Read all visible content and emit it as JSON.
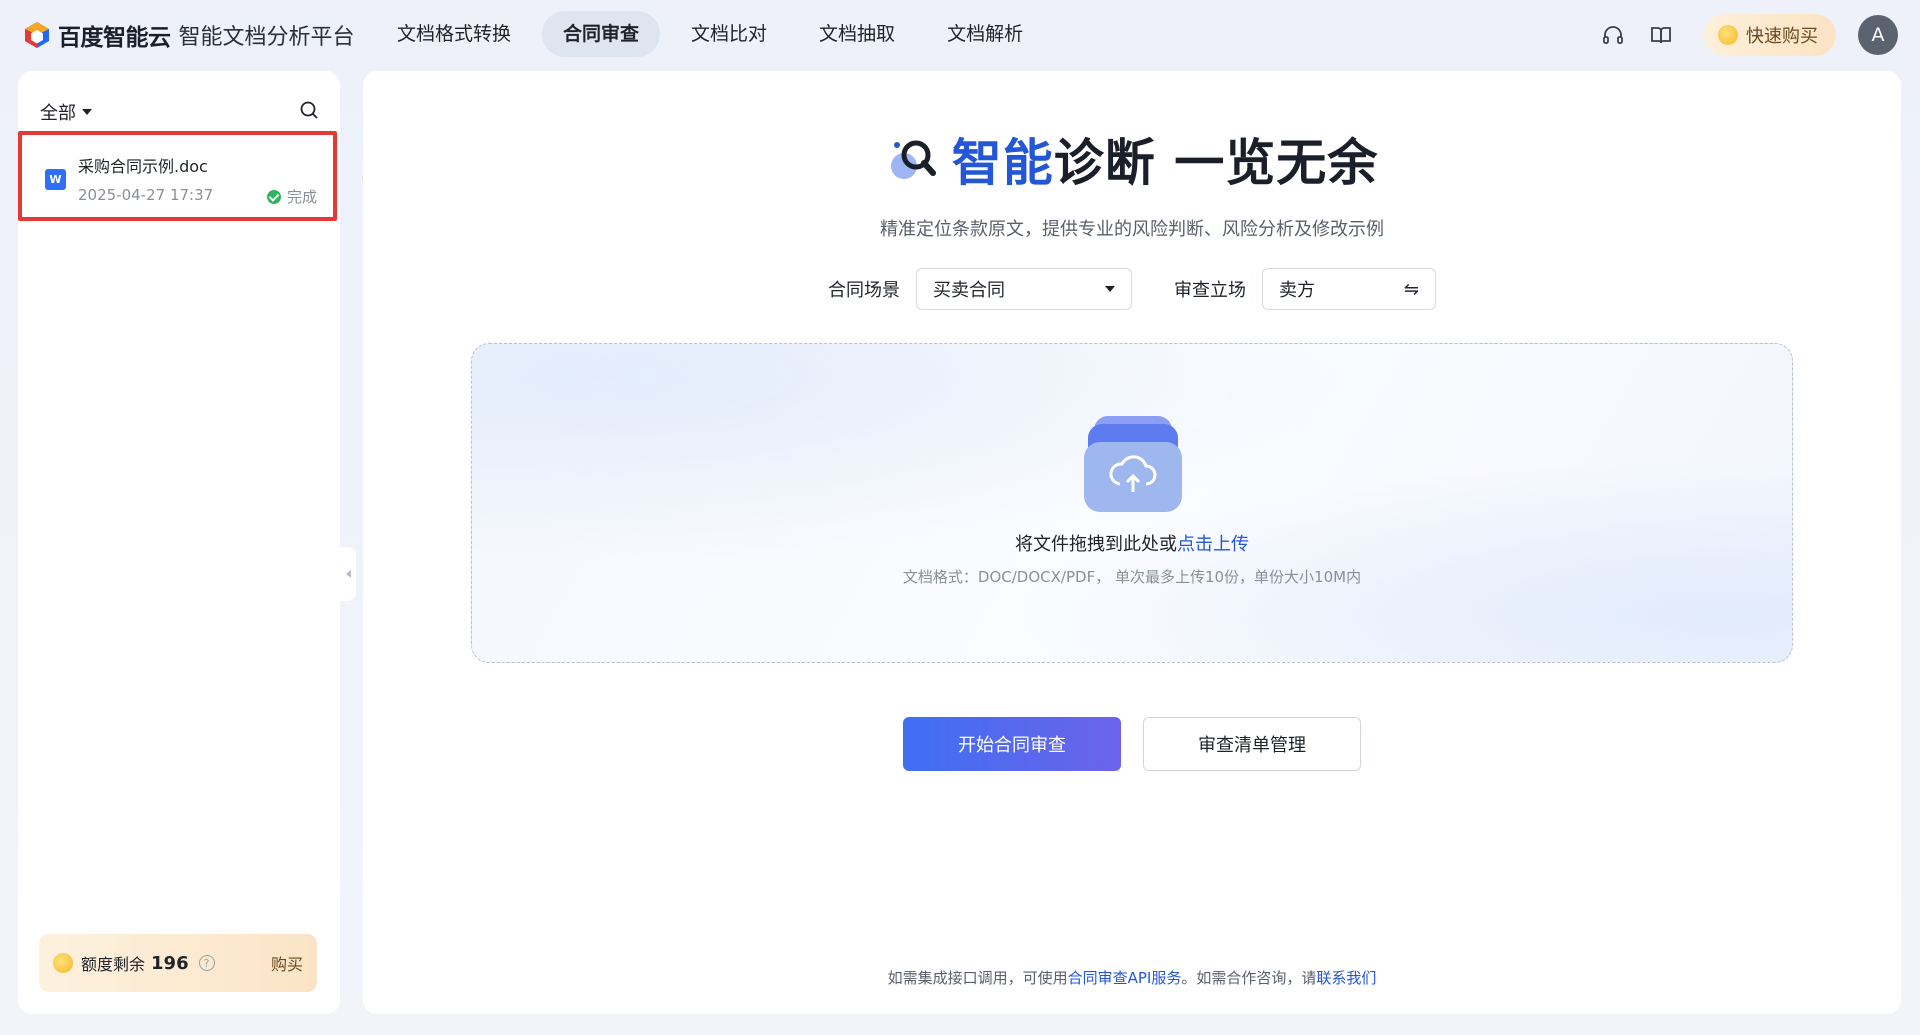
{
  "header": {
    "brand": "百度智能云",
    "product": "智能文档分析平台",
    "nav": [
      {
        "label": "文档格式转换",
        "active": false
      },
      {
        "label": "合同审查",
        "active": true
      },
      {
        "label": "文档比对",
        "active": false
      },
      {
        "label": "文档抽取",
        "active": false
      },
      {
        "label": "文档解析",
        "active": false
      }
    ],
    "buy_label": "快速购买",
    "avatar_letter": "A"
  },
  "sidebar": {
    "filter_label": "全部",
    "files": [
      {
        "icon_letter": "W",
        "name": "采购合同示例.doc",
        "date": "2025-04-27 17:37",
        "status": "完成"
      }
    ],
    "quota": {
      "label": "额度剩余",
      "value": "196",
      "help": "?",
      "buy_label": "购买"
    }
  },
  "main": {
    "title_blue": "智能",
    "title_rest": "诊断 一览无余",
    "subtitle": "精准定位条款原文，提供专业的风险判断、风险分析及修改示例",
    "scene_label": "合同场景",
    "scene_value": "买卖合同",
    "stance_label": "审查立场",
    "stance_value": "卖方",
    "upload": {
      "text": "将文件拖拽到此处或",
      "link": "点击上传",
      "hint": "文档格式：DOC/DOCX/PDF， 单次最多上传10份，单份大小10M内"
    },
    "start_button": "开始合同审查",
    "manage_button": "审查清单管理",
    "footer": {
      "prefix": "如需集成接口调用，可使用",
      "api_link": "合同审查API服务",
      "middle": "。如需合作咨询，请",
      "contact_link": "联系我们"
    }
  },
  "colors": {
    "accent": "#2457d6",
    "highlight_border": "#e53935",
    "success": "#2fb560"
  }
}
